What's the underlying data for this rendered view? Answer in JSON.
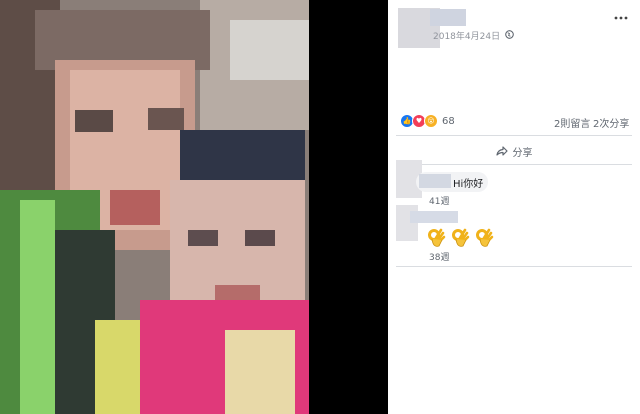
{
  "post": {
    "date": "2018年4月24日",
    "reaction_count": "68",
    "comment_count": "2則留言",
    "share_count": "2次分享",
    "share_label": "分享"
  },
  "comments": [
    {
      "text": "Hi你好",
      "time": "41週"
    },
    {
      "text": "👌👌👌",
      "time": "38週"
    }
  ],
  "icons": [
    "globe-icon",
    "more-icon",
    "like-reaction-icon",
    "love-reaction-icon",
    "wow-reaction-icon",
    "share-arrow-icon",
    "ok-hand-emoji"
  ],
  "colors": {
    "link_blue": "#1877f2",
    "love_red": "#f33e58",
    "wow_yellow": "#f7b125",
    "meta_gray": "#90949c"
  }
}
